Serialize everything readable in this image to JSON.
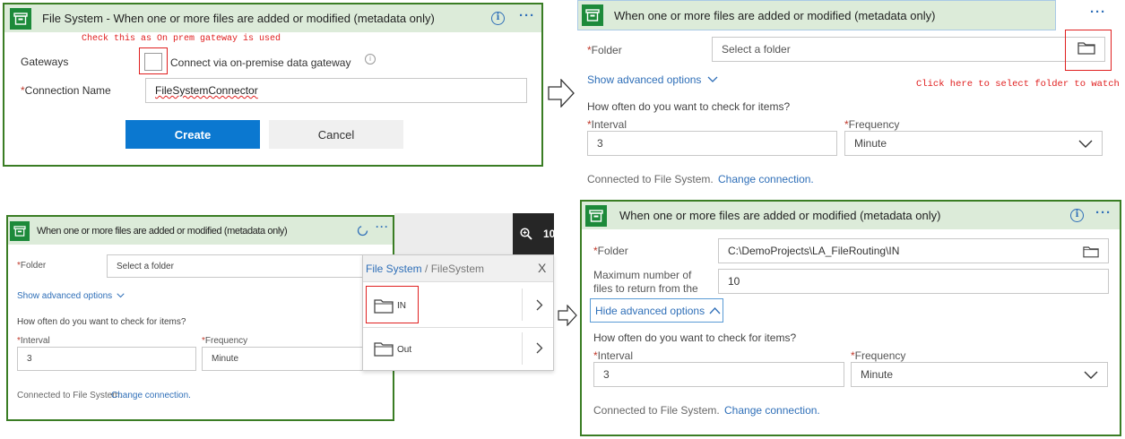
{
  "panel1": {
    "title": "File System - When one or more files are added or modified (metadata only)",
    "annotation": "Check this as On prem gateway is used",
    "gateways_label": "Gateways",
    "gateway_checkbox_label": "Connect via on-premise data gateway",
    "connection_name_label": "Connection Name",
    "required_mark": "*",
    "connection_name_value": "FileSystemConnector",
    "create_button": "Create",
    "cancel_button": "Cancel"
  },
  "panel2": {
    "title": "When one or more files are added or modified (metadata only)",
    "folder_label": "Folder",
    "folder_placeholder": "Select a folder",
    "annotation": "Click here to select folder to watch",
    "advanced_link": "Show advanced options",
    "check_question": "How often do you want to check for items?",
    "interval_label": "Interval",
    "interval_value": "3",
    "frequency_label": "Frequency",
    "frequency_value": "Minute",
    "connected_text": "Connected to File System.",
    "change_connection": "Change connection."
  },
  "panel3": {
    "title": "When one or more files are added or modified (metadata only)",
    "folder_label": "Folder",
    "folder_placeholder": "Select a folder",
    "advanced_link": "Show advanced options",
    "check_question": "How often do you want to check for items?",
    "interval_label": "Interval",
    "interval_value": "3",
    "frequency_label": "Frequency",
    "frequency_value": "Minute",
    "connected_text": "Connected to File System.",
    "change_connection": "Change connection.",
    "toolbar_partial": "10"
  },
  "picker": {
    "breadcrumb_root": "File System",
    "breadcrumb_sep": " / ",
    "breadcrumb_current": "FileSystem",
    "close": "X",
    "items": [
      {
        "label": "IN"
      },
      {
        "label": "Out"
      }
    ]
  },
  "panel4": {
    "title": "When one or more files are added or modified (metadata only)",
    "folder_label": "Folder",
    "folder_value": "C:\\DemoProjects\\LA_FileRouting\\IN",
    "max_files_label_line1": "Maximum number of",
    "max_files_label_line2": "files to return from the",
    "max_files_value": "10",
    "advanced_link": "Hide advanced options",
    "check_question": "How often do you want to check for items?",
    "interval_label": "Interval",
    "interval_value": "3",
    "frequency_label": "Frequency",
    "frequency_value": "Minute",
    "connected_text": "Connected to File System.",
    "change_connection": "Change connection."
  },
  "colors": {
    "header_bg": "#dcebd9",
    "brand_green": "#1d8a3a",
    "border_green": "#3a7d24",
    "link_blue": "#2f6fb8",
    "primary_button": "#0b78d0",
    "annotation_red": "#e02020"
  },
  "icons": [
    "file-system-connector-icon",
    "info-icon",
    "more-options-icon",
    "folder-icon",
    "chevron-down-icon",
    "chevron-up-icon",
    "chevron-right-icon",
    "zoom-icon",
    "spinner-icon",
    "close-icon",
    "arrow-right-icon"
  ]
}
